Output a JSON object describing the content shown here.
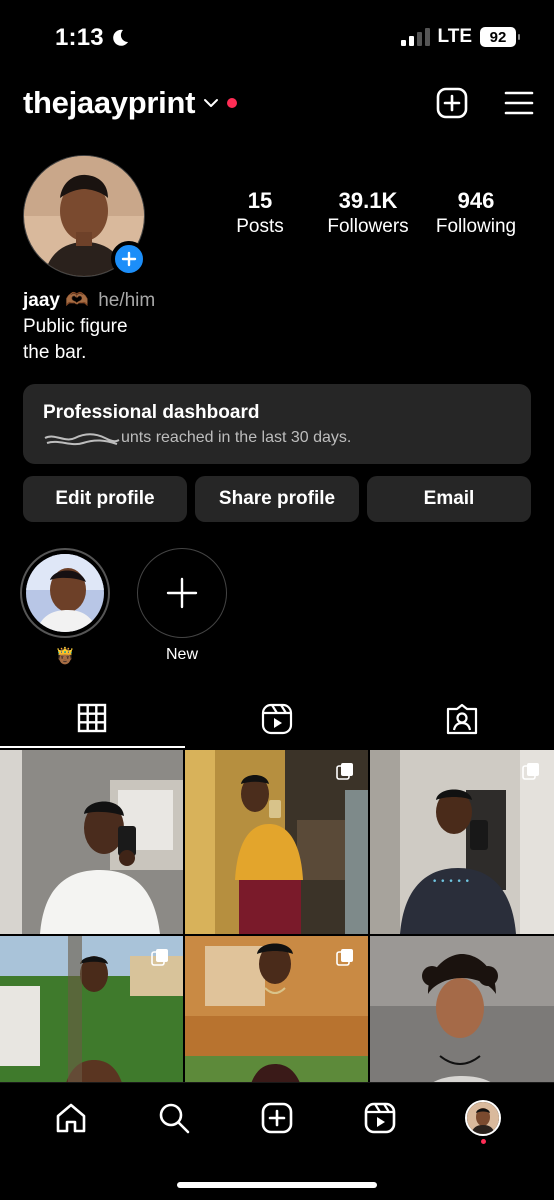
{
  "status_bar": {
    "time": "1:13",
    "network": "LTE",
    "battery": "92"
  },
  "header": {
    "username": "thejaayprint"
  },
  "profile": {
    "stats": [
      {
        "value": "15",
        "label": "Posts"
      },
      {
        "value": "39.1K",
        "label": "Followers"
      },
      {
        "value": "946",
        "label": "Following"
      }
    ],
    "name": "jaay 🫶🏾",
    "pronouns": "he/him",
    "category": "Public figure",
    "bio": "the bar."
  },
  "dashboard": {
    "title": "Professional dashboard",
    "subtitle": "unts reached in the last 30 days."
  },
  "actions": {
    "edit": "Edit profile",
    "share": "Share profile",
    "email": "Email"
  },
  "highlights": [
    {
      "label": "🤴🏾"
    },
    {
      "label": "New"
    }
  ],
  "tabs": [
    "grid-icon",
    "reels-icon",
    "tagged-icon"
  ],
  "posts": [
    {
      "multi": false
    },
    {
      "multi": true
    },
    {
      "multi": true
    },
    {
      "multi": true
    },
    {
      "multi": true
    },
    {
      "multi": false
    }
  ],
  "colors": {
    "accent_blue": "#1c8ef9",
    "notification_red": "#ff2d55",
    "surface": "#262626"
  }
}
